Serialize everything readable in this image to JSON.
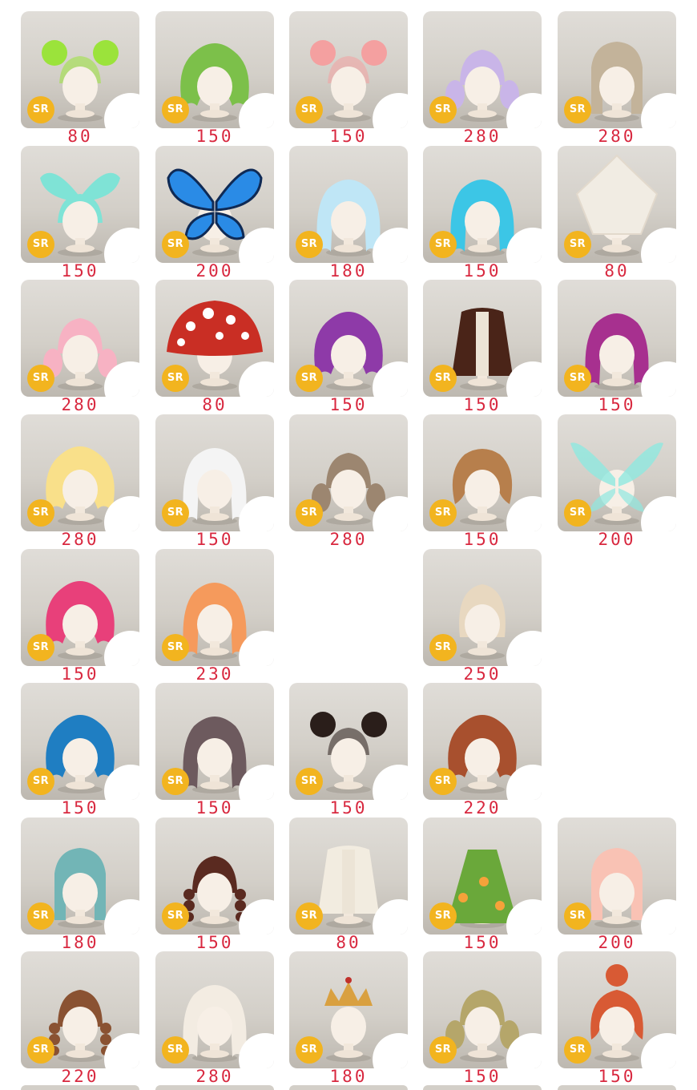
{
  "badge_label": "SR",
  "items": [
    {
      "price": "80",
      "hair": "#9be33b",
      "style": "buns"
    },
    {
      "price": "150",
      "hair": "#7cc04a",
      "style": "curly"
    },
    {
      "price": "150",
      "hair": "#f4a0a0",
      "style": "buns"
    },
    {
      "price": "280",
      "hair": "#c9b5e8",
      "style": "twin"
    },
    {
      "price": "280",
      "hair": "#c3b39a",
      "style": "straight"
    },
    {
      "price": "150",
      "hair": "#7fe3d6",
      "style": "wings"
    },
    {
      "price": "200",
      "hair": "#2a8be6",
      "style": "butterfly"
    },
    {
      "price": "180",
      "hair": "#bfe6f6",
      "style": "long"
    },
    {
      "price": "150",
      "hair": "#3cc6e6",
      "style": "long"
    },
    {
      "price": "80",
      "hair": "#f1ece3",
      "style": "hood"
    },
    {
      "price": "280",
      "hair": "#f7b2c3",
      "style": "twin"
    },
    {
      "price": "80",
      "hair": "#c92e24",
      "style": "mushroom"
    },
    {
      "price": "150",
      "hair": "#8e3aa8",
      "style": "curly"
    },
    {
      "price": "150",
      "hair": "#4a2418",
      "style": "coat"
    },
    {
      "price": "150",
      "hair": "#a7308f",
      "style": "long"
    },
    {
      "price": "280",
      "hair": "#f9e08a",
      "style": "curly"
    },
    {
      "price": "150",
      "hair": "#f4f4f4",
      "style": "long"
    },
    {
      "price": "280",
      "hair": "#9c8670",
      "style": "twin"
    },
    {
      "price": "150",
      "hair": "#b77f4c",
      "style": "bob"
    },
    {
      "price": "200",
      "hair": "#8ee8e0",
      "style": "fairy"
    },
    {
      "price": "150",
      "hair": "#e8407a",
      "style": "curly"
    },
    {
      "price": "230",
      "hair": "#f59a5c",
      "style": "long"
    },
    null,
    {
      "price": "250",
      "hair": "#e8d8c0",
      "style": "bald"
    },
    null,
    {
      "price": "150",
      "hair": "#1f7ec2",
      "style": "curly"
    },
    {
      "price": "150",
      "hair": "#6d5a5e",
      "style": "long"
    },
    {
      "price": "150",
      "hair": "#2a1e1a",
      "style": "buns"
    },
    {
      "price": "220",
      "hair": "#a8502e",
      "style": "curly"
    },
    null,
    {
      "price": "180",
      "hair": "#72b5b6",
      "style": "straight"
    },
    {
      "price": "150",
      "hair": "#5a2a20",
      "style": "braid"
    },
    {
      "price": "80",
      "hair": "#f2ece0",
      "style": "coat"
    },
    {
      "price": "150",
      "hair": "#6aa83a",
      "style": "dress"
    },
    {
      "price": "200",
      "hair": "#f9c2b4",
      "style": "straight"
    },
    {
      "price": "220",
      "hair": "#8a5232",
      "style": "braid"
    },
    {
      "price": "280",
      "hair": "#f3ece2",
      "style": "long"
    },
    {
      "price": "180",
      "hair": "#d9a040",
      "style": "crown"
    },
    {
      "price": "150",
      "hair": "#b5a66a",
      "style": "twin"
    },
    {
      "price": "150",
      "hair": "#d85a34",
      "style": "bun"
    }
  ]
}
